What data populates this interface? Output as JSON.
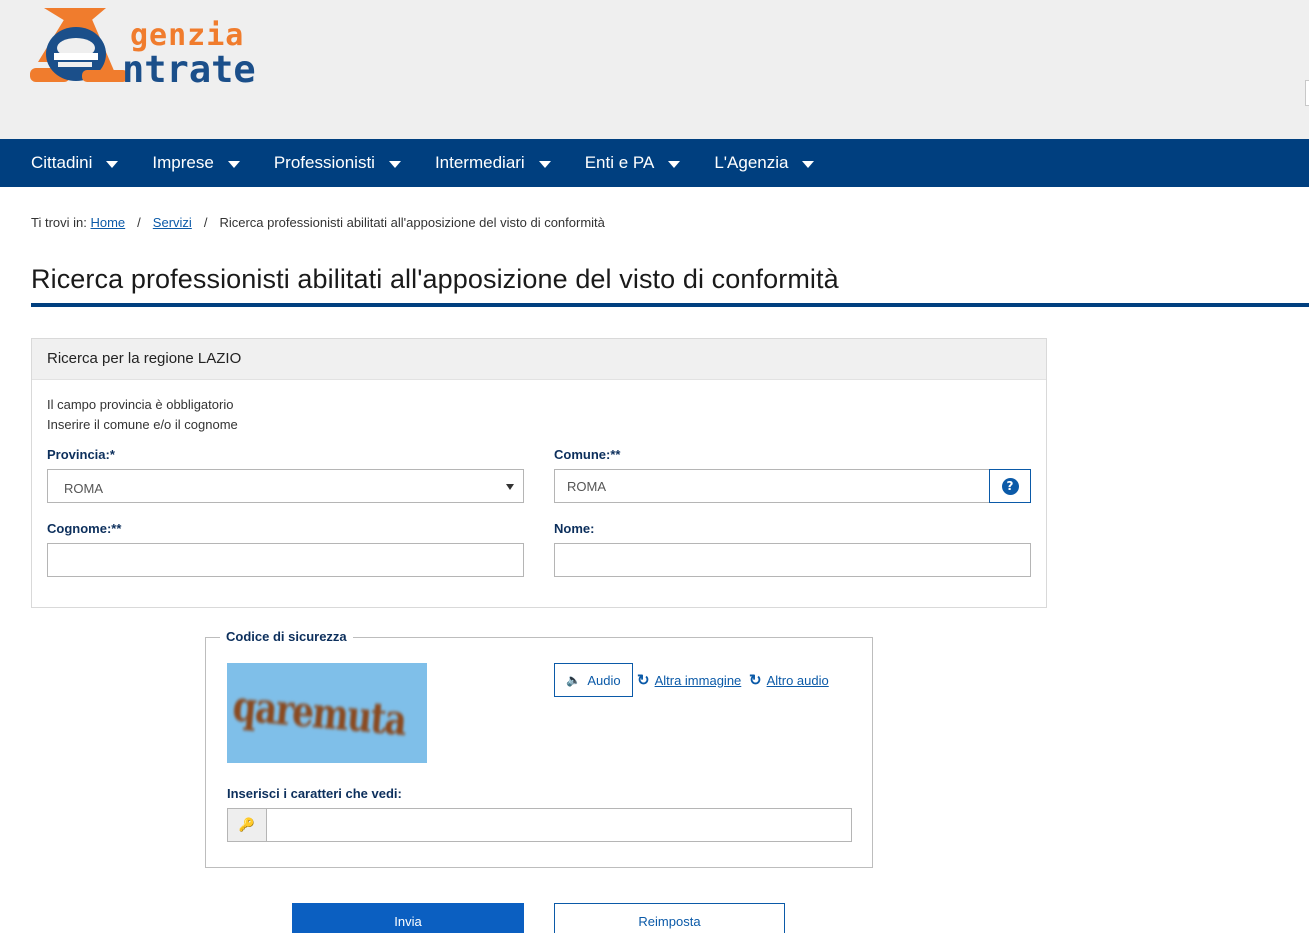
{
  "brand": {
    "logo_word1": "genzia",
    "logo_word2": "ntrate",
    "colors": {
      "orange": "#f07c2d",
      "blue": "#1b4f8a",
      "nav": "#003f7f"
    }
  },
  "nav": {
    "items": [
      {
        "label": "Cittadini"
      },
      {
        "label": "Imprese"
      },
      {
        "label": "Professionisti"
      },
      {
        "label": "Intermediari"
      },
      {
        "label": "Enti e PA"
      },
      {
        "label": "L'Agenzia"
      }
    ]
  },
  "breadcrumb": {
    "prefix": "Ti trovi in:",
    "home": "Home",
    "servizi": "Servizi",
    "current": "Ricerca professionisti abilitati all'apposizione del visto di conformità",
    "separator": "/"
  },
  "page": {
    "title": "Ricerca professionisti abilitati all'apposizione del visto di conformità"
  },
  "search": {
    "heading": "Ricerca per la regione LAZIO",
    "hint1": "Il campo provincia è obbligatorio",
    "hint2": "Inserire il comune e/o il cognome",
    "provincia_label": "Provincia:*",
    "provincia_value": "ROMA",
    "comune_label": "Comune:**",
    "comune_value": "ROMA",
    "cognome_label": "Cognome:**",
    "cognome_value": "",
    "nome_label": "Nome:",
    "nome_value": ""
  },
  "captcha": {
    "legend": "Codice di sicurezza",
    "image_text": "qaremuta",
    "audio_label": "Audio",
    "altra_immagine": "Altra immagine",
    "altro_audio": "Altro audio",
    "input_label": "Inserisci i caratteri che vedi:",
    "input_value": ""
  },
  "buttons": {
    "submit": "Invia",
    "reset": "Reimposta"
  }
}
